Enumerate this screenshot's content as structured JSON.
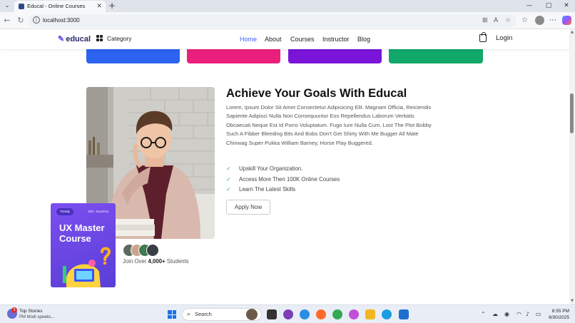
{
  "browser": {
    "tab_title": "Educal - Online Courses",
    "url": "localhost:3000"
  },
  "site": {
    "logo": "educal",
    "category": "Category",
    "nav": [
      "Home",
      "About",
      "Courses",
      "Instructor",
      "Blog"
    ],
    "login": "Login"
  },
  "section": {
    "heading": "Achieve Your Goals With Educal",
    "paragraph": "Lorem, Ipsum Dolor Sit Amet Consectetur Adipisicing Elit. Magnam Officia, Reiciendis Sapiente Adipisci Nulla Non Consequuntur Eos Repellendus Laborum Veritatis Obcaecati Neque Est Id Porro Voluptatum. Fugo Iure Nulla Cum. Lost The Plot Bobby Such A Fibber Bleeding Bits And Bobs Don't Get Shirty With Me Bugger All Mate Chinwag Super Pukka William Barney, Horse Play Buggered.",
    "features": [
      "Upskill Your Organization.",
      "Access More Then 100K Online Courses",
      "Learn The Latest Skills"
    ],
    "button": "Apply Now",
    "join_prefix": "Join Over",
    "join_count": "4,000+",
    "join_suffix": "Students"
  },
  "promo": {
    "tag": "Trendy",
    "students": "480+ Students",
    "title": "UX Master Course"
  },
  "colors": {
    "card1": "#2c63f0",
    "card2": "#ea1f7c",
    "card3": "#7b14d9",
    "card4": "#11a86a",
    "accent": "#3a60ff"
  },
  "taskbar": {
    "news_badge": "3",
    "news_title": "Top Stories",
    "news_sub": "PM Modi speaks...",
    "search": "Search",
    "time": "8:55 PM",
    "date": "8/30/2025"
  }
}
